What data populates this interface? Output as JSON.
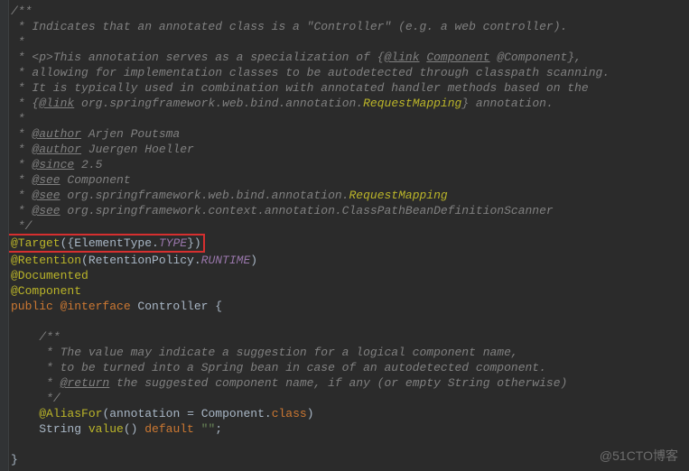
{
  "doc": {
    "l1": "/**",
    "l2": " * Indicates that an annotated class is a \"Controller\" (e.g. a web controller).",
    "l3": " *",
    "l4_pre": " * ",
    "l4_tag": "<p>",
    "l4_txt": "This annotation serves as a specialization of {",
    "l4_link": "@link",
    "l4_sp": " ",
    "l4_ref": "Component",
    "l4_txt2": " @Component},",
    "l5": " * allowing for implementation classes to be autodetected through classpath scanning.",
    "l6": " * It is typically used in combination with annotated handler methods based on the",
    "l7_pre": " * {",
    "l7_link": "@link",
    "l7_sp": " ",
    "l7_ref1": "org.springframework.web.bind.annotation.",
    "l7_ref2": "RequestMapping",
    "l7_post": "} annotation.",
    "l8": " *",
    "l9_pre": " * ",
    "l9_tag": "@author",
    "l9_val": " Arjen Poutsma",
    "l10_pre": " * ",
    "l10_tag": "@author",
    "l10_val": " Juergen Hoeller",
    "l11_pre": " * ",
    "l11_tag": "@since",
    "l11_val": " 2.5",
    "l12_pre": " * ",
    "l12_tag": "@see",
    "l12_val": " Component",
    "l13_pre": " * ",
    "l13_tag": "@see",
    "l13_val1": " org.springframework.web.bind.annotation.",
    "l13_val2": "RequestMapping",
    "l14_pre": " * ",
    "l14_tag": "@see",
    "l14_val": " org.springframework.context.annotation.ClassPathBeanDefinitionScanner",
    "l15": " */"
  },
  "code": {
    "target_anno": "@Target",
    "target_paren_open": "({",
    "target_enum1": "ElementType.",
    "target_enum2": "TYPE",
    "target_paren_close": "})",
    "retention_anno": "@Retention",
    "retention_po": "(",
    "retention_enum1": "RetentionPolicy.",
    "retention_enum2": "RUNTIME",
    "retention_pc": ")",
    "documented": "@Documented",
    "component": "@Component",
    "kw_public": "public ",
    "kw_interface": "@interface",
    "class_name": " Controller ",
    "brace_open": "{",
    "brace_close": "}"
  },
  "inner_doc": {
    "pad": "    ",
    "l1": "/**",
    "l2": " * The value may indicate a suggestion for a logical component name,",
    "l3": " * to be turned into a Spring bean in case of an autodetected component.",
    "l4_pre": " * ",
    "l4_tag": "@return",
    "l4_val": " the suggested component name, if any (or empty String otherwise)",
    "l5": " */"
  },
  "method": {
    "pad": "    ",
    "alias_anno": "@AliasFor",
    "alias_po": "(",
    "alias_arg": "annotation ",
    "alias_eq": "= ",
    "alias_val": "Component.",
    "alias_kw": "class",
    "alias_pc": ")",
    "ret_type": "String ",
    "name": "value",
    "paren": "() ",
    "kw_default": "default ",
    "str": "\"\"",
    "semi": ";"
  },
  "watermark": "@51CTO博客"
}
